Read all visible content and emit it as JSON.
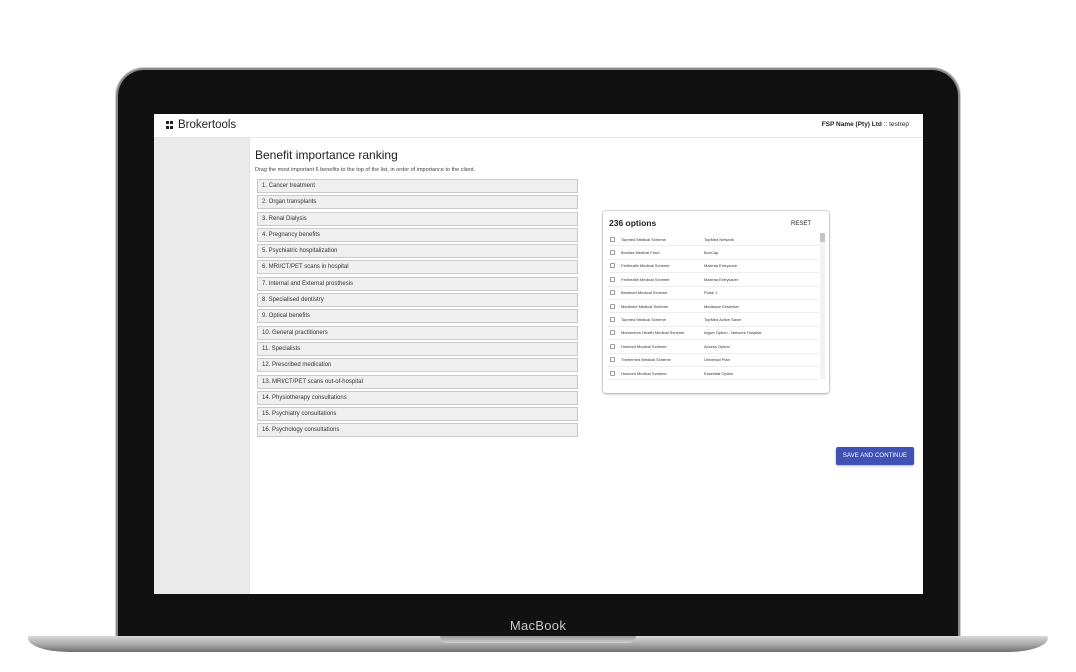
{
  "device": {
    "label": "MacBook"
  },
  "header": {
    "brand": "Brokertools",
    "fsp_name": "FSP Name (Pty) Ltd",
    "user_suffix": ":: testrep"
  },
  "main": {
    "title": "Benefit importance ranking",
    "subtitle": "Drag the most important 6 benefits to the top of the list, in order of importance to the client.",
    "benefits": [
      "1. Cancer treatment",
      "2. Organ transplants",
      "3. Renal Dialysis",
      "4. Pregnancy benefits",
      "5. Psychiatric hospitalization",
      "6. MRI/CT/PET scans in hospital",
      "7. Internal and External prosthesis",
      "8. Specialised dentistry",
      "9. Optical benefits",
      "10. General practitioners",
      "11. Specialists",
      "12. Prescribed medication",
      "13. MRI/CT/PET scans out-of-hospital",
      "14. Physiotherapy consultations",
      "15. Psychiatry consultations",
      "16. Psychology consultations"
    ]
  },
  "options": {
    "count_label": "236 options",
    "reset_label": "RESET",
    "rows": [
      {
        "scheme": "Topmed Medical Scheme",
        "plan": "TopMed Network"
      },
      {
        "scheme": "Bonitas Medical Fund",
        "plan": "BonCap"
      },
      {
        "scheme": "Fedhealth Medical Scheme",
        "plan": "Maxima Entryzone"
      },
      {
        "scheme": "Fedhealth Medical Scheme",
        "plan": "Maxima Entrysaver"
      },
      {
        "scheme": "Bestmed Medical Scheme",
        "plan": "Pulse 1"
      },
      {
        "scheme": "Medimed Medical Scheme",
        "plan": "Medisave Essential"
      },
      {
        "scheme": "Topmed Medical Scheme",
        "plan": "TopMed Active Saver"
      },
      {
        "scheme": "Momentum Health Medical Scheme",
        "plan": "Ingwe Option - Network Hospital"
      },
      {
        "scheme": "Hosmed Medical Scheme",
        "plan": "Access Option"
      },
      {
        "scheme": "Thebemed Medical Scheme",
        "plan": "Universal Plan"
      },
      {
        "scheme": "Hosmed Medical Scheme",
        "plan": "Essential Option"
      }
    ]
  },
  "actions": {
    "save_label": "SAVE AND CONTINUE"
  },
  "colors": {
    "primary": "#3f51b5",
    "sidebar": "#ebebeb"
  }
}
